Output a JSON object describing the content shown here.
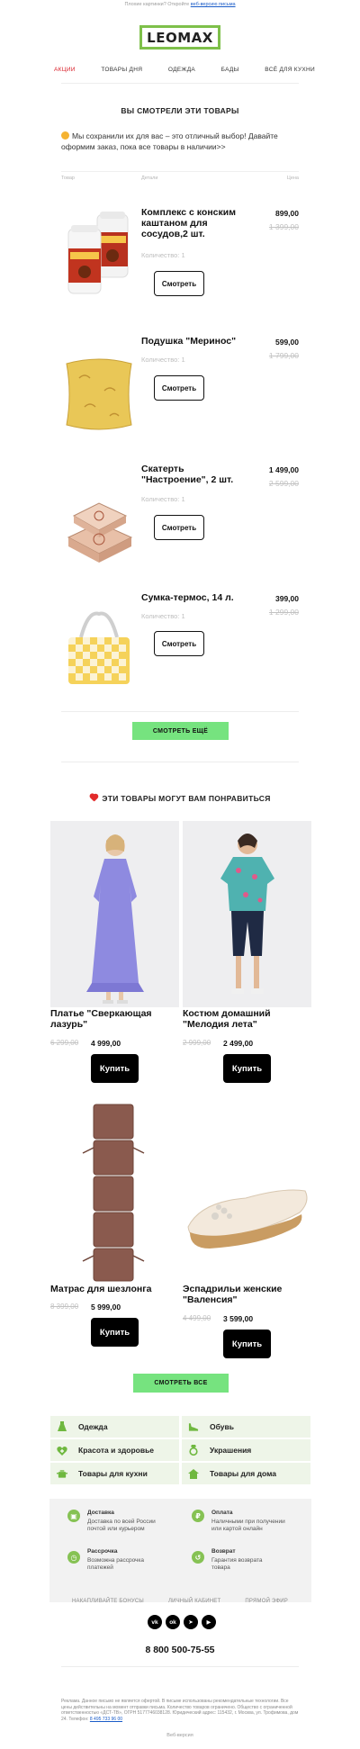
{
  "preheader": {
    "text": "Плохие картинки? Откройте",
    "link": "веб-версию письма"
  },
  "logo": "LEOMAX",
  "menu": [
    "АКЦИИ",
    "ТОВАРЫ ДНЯ",
    "ОДЕЖДА",
    "БАДЫ",
    "ВСЁ ДЛЯ КУХНИ"
  ],
  "viewed": {
    "title": "ВЫ СМОТРЕЛИ ЭТИ ТОВАРЫ",
    "intro": "Мы сохранили их для вас – это отличный выбор! Давайте оформим заказ, пока все товары в наличии>>",
    "col_product": "Товар",
    "col_details": "Детали",
    "col_price": "Цена",
    "see_label": "Смотреть",
    "items": [
      {
        "name": "Комплекс с конским каштаном для сосудов,2 шт.",
        "qty": "Количество: 1",
        "price": "899,00",
        "old": "1 399,00"
      },
      {
        "name": "Подушка \"Меринос\"",
        "qty": "Количество: 1",
        "price": "599,00",
        "old": "1 799,00"
      },
      {
        "name": "Скатерть \"Настроение\", 2 шт.",
        "qty": "Количество: 1",
        "price": "1 499,00",
        "old": "2 599,00"
      },
      {
        "name": "Сумка-термос, 14 л.",
        "qty": "Количество: 1",
        "price": "399,00",
        "old": "1 299,00"
      }
    ],
    "more_button": "СМОТРЕТЬ ЕЩЁ"
  },
  "recommend": {
    "title": "ЭТИ ТОВАРЫ МОГУТ ВАМ ПОНРАВИТЬСЯ",
    "buy_label": "Купить",
    "items": [
      {
        "name": "Платье \"Сверкающая лазурь\"",
        "old": "6 299,00",
        "price": "4 999,00"
      },
      {
        "name": "Костюм домашний \"Мелодия лета\"",
        "old": "2 999,00",
        "price": "2 499,00"
      },
      {
        "name": "Матрас для шезлонга",
        "old": "8 399,00",
        "price": "5 999,00"
      },
      {
        "name": "Эспадрильи женские \"Валенсия\"",
        "old": "4 499,00",
        "price": "3 599,00"
      }
    ],
    "all_button": "СМОТРЕТЬ ВСЕ"
  },
  "categories": [
    {
      "label": "Одежда",
      "icon": "dress-icon"
    },
    {
      "label": "Обувь",
      "icon": "shoe-icon"
    },
    {
      "label": "Красота и здоровье",
      "icon": "heart-plus-icon"
    },
    {
      "label": "Украшения",
      "icon": "ring-icon"
    },
    {
      "label": "Товары для кухни",
      "icon": "pot-icon"
    },
    {
      "label": "Товары для дома",
      "icon": "house-icon"
    }
  ],
  "info": [
    {
      "title": "Доставка",
      "text": "Доставка по всей России почтой или курьером"
    },
    {
      "title": "Оплата",
      "text": "Наличными при получении или картой онлайн"
    },
    {
      "title": "Рассрочка",
      "text": "Возможна рассрочка платежей"
    },
    {
      "title": "Возврат",
      "text": "Гарантия возврата товара"
    }
  ],
  "footer_links": [
    "НАКАПЛИВАЙТЕ БОНУСЫ",
    "ЛИЧНЫЙ КАБИНЕТ",
    "ПРЯМОЙ ЭФИР"
  ],
  "social": [
    "vk-icon",
    "ok-icon",
    "telegram-icon",
    "youtube-icon"
  ],
  "phone": "8 800 500-75-55",
  "legal": "Реклама. Данное письмо не является офертой. В письме использованы рекомендательные технологии. Все цены действительны на момент отправки письма. Количество товаров ограничено. Общество с ограниченной ответственностью «ДСТ-ТВ», ОГРН 5177746038128. Юридический адрес: 115432, г. Москва, ул. Трофимова, дом 24. Телефон:",
  "legal_phone": "8 495 733 96 00",
  "web_version": "Веб-версия",
  "colors": {
    "accent_green": "#76e37f",
    "logo_green": "#7ec04a",
    "active_red": "#d9202a",
    "category_bg": "#eef5e8"
  }
}
